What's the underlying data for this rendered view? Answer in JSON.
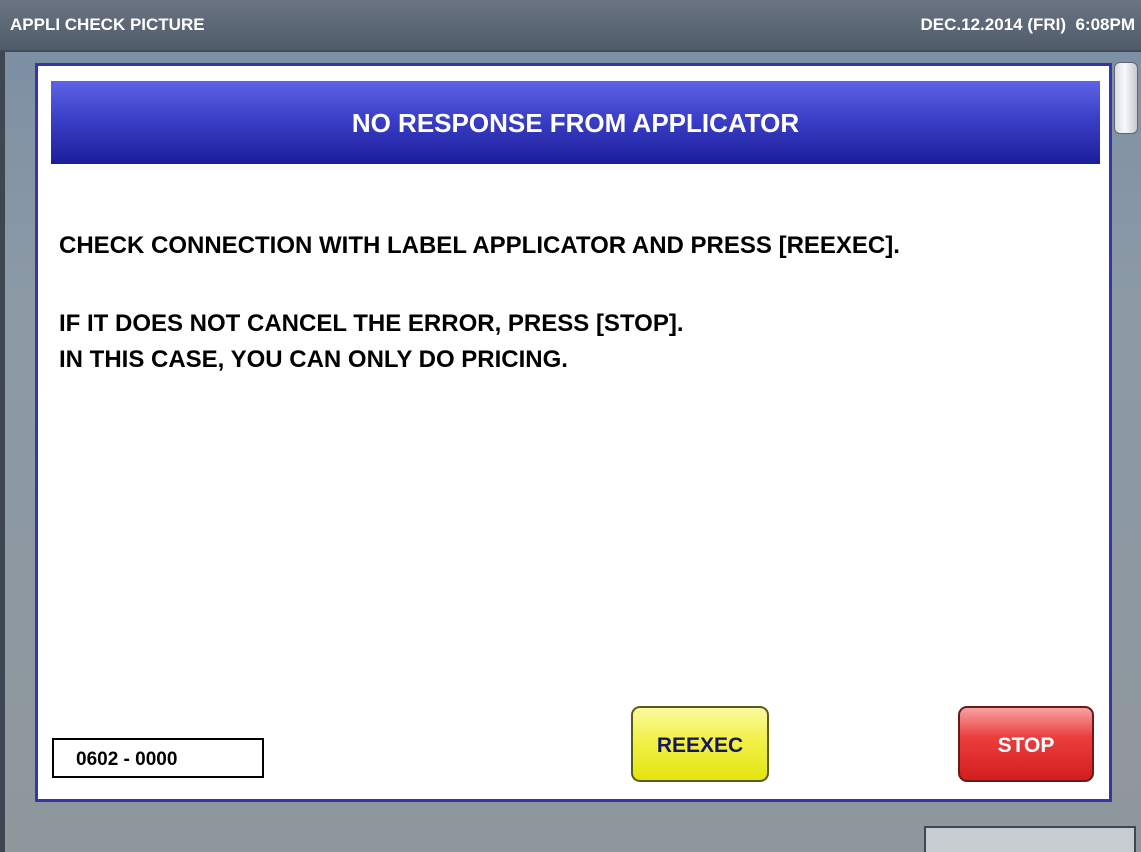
{
  "window": {
    "title": "APPLI CHECK PICTURE",
    "datetime": "DEC.12.2014 (FRI)  6:08PM"
  },
  "dialog": {
    "title": "NO RESPONSE FROM APPLICATOR",
    "messages": [
      "CHECK CONNECTION WITH LABEL APPLICATOR AND PRESS [REEXEC].",
      "IF IT DOES NOT CANCEL THE ERROR, PRESS [STOP].",
      "IN THIS CASE, YOU CAN ONLY DO PRICING."
    ],
    "error_code": "0602 - 0000",
    "buttons": {
      "reexec": "REEXEC",
      "stop": "STOP"
    }
  },
  "colors": {
    "header_blue": "#3b3fc8",
    "dialog_border": "#3636a8",
    "reexec_yellow": "#f2f250",
    "stop_red": "#ec3e3e",
    "background": "#8c9aa6"
  }
}
